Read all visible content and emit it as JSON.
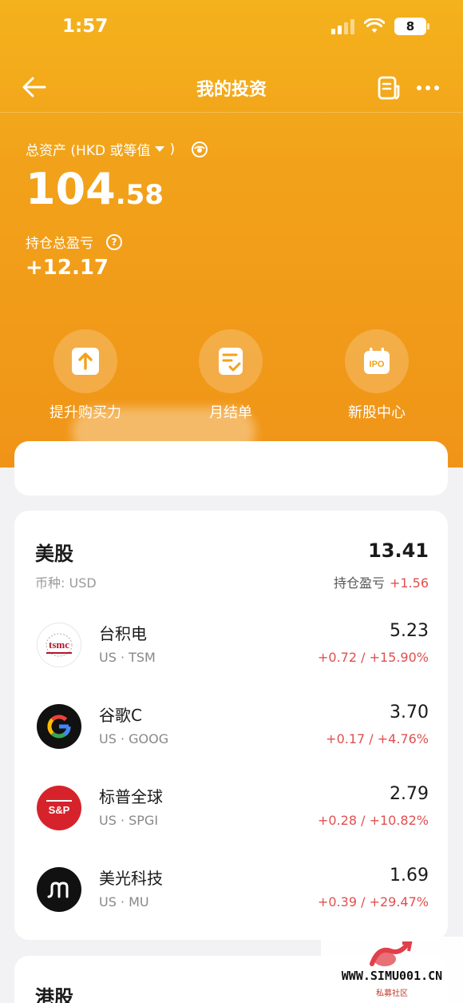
{
  "status_bar": {
    "time": "1:57",
    "battery": "8"
  },
  "nav": {
    "title": "我的投资"
  },
  "assets": {
    "label": "总资产 (HKD 或等值",
    "label_suffix": ")",
    "value_int": "104",
    "value_dec": ".58",
    "pnl_label": "持仓总盈亏",
    "pnl_value": "+12.17"
  },
  "quick_actions": [
    {
      "label": "提升购买力",
      "icon": "upload-arrow-icon"
    },
    {
      "label": "月结单",
      "icon": "statement-icon"
    },
    {
      "label": "新股中心",
      "icon": "ipo-calendar-icon",
      "icon_text": "IPO"
    }
  ],
  "us_market": {
    "title": "美股",
    "total": "13.41",
    "currency": "币种: USD",
    "pnl_label": "持仓盈亏",
    "pnl_value": "+1.56",
    "stocks": [
      {
        "name": "台积电",
        "code": "US · TSM",
        "value": "5.23",
        "change": "+0.72 / +15.90%",
        "logo": "tsmc-logo",
        "logo_text": "tsmc"
      },
      {
        "name": "谷歌C",
        "code": "US · GOOG",
        "value": "3.70",
        "change": "+0.17 / +4.76%",
        "logo": "google-logo",
        "logo_text": "G"
      },
      {
        "name": "标普全球",
        "code": "US · SPGI",
        "value": "2.79",
        "change": "+0.28 / +10.82%",
        "logo": "sp-logo",
        "logo_text": "S&P"
      },
      {
        "name": "美光科技",
        "code": "US · MU",
        "value": "1.69",
        "change": "+0.39 / +29.47%",
        "logo": "micron-logo",
        "logo_text": "m"
      }
    ]
  },
  "hk_market": {
    "title": "港股"
  },
  "watermark": {
    "text": "WWW.SIMU001.CN",
    "sub": "私募社区"
  },
  "colors": {
    "accent": "#f2a21a",
    "up": "#e05050"
  }
}
